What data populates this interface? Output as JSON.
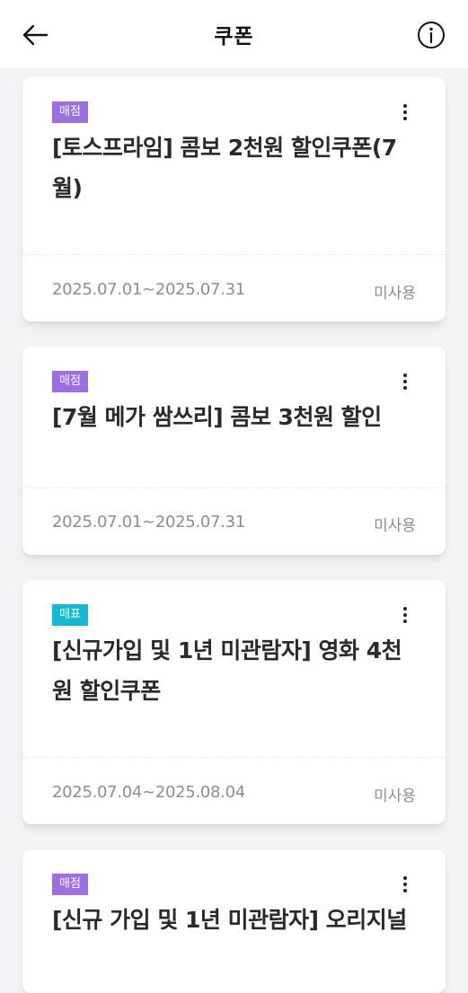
{
  "header": {
    "title": "쿠폰",
    "back_icon": "arrow-left-icon",
    "info_icon": "info-circle-icon"
  },
  "colors": {
    "badge_store": "#9b6fe0",
    "badge_ticket": "#17b8cf"
  },
  "coupons": [
    {
      "badge": "매점",
      "badge_type": "store",
      "title": "[토스프라임] 콤보 2천원 할인쿠폰(7월)",
      "period": "2025.07.01~2025.07.31",
      "status": "미사용"
    },
    {
      "badge": "매점",
      "badge_type": "store",
      "title": "[7월 메가 쌈쓰리] 콤보 3천원 할인",
      "period": "2025.07.01~2025.07.31",
      "status": "미사용"
    },
    {
      "badge": "매표",
      "badge_type": "ticket",
      "title": "[신규가입 및 1년 미관람자] 영화 4천원 할인쿠폰",
      "period": "2025.07.04~2025.08.04",
      "status": "미사용"
    },
    {
      "badge": "매점",
      "badge_type": "store",
      "title": "[신규 가입 및 1년 미관람자] 오리지널",
      "period": "",
      "status": ""
    }
  ]
}
